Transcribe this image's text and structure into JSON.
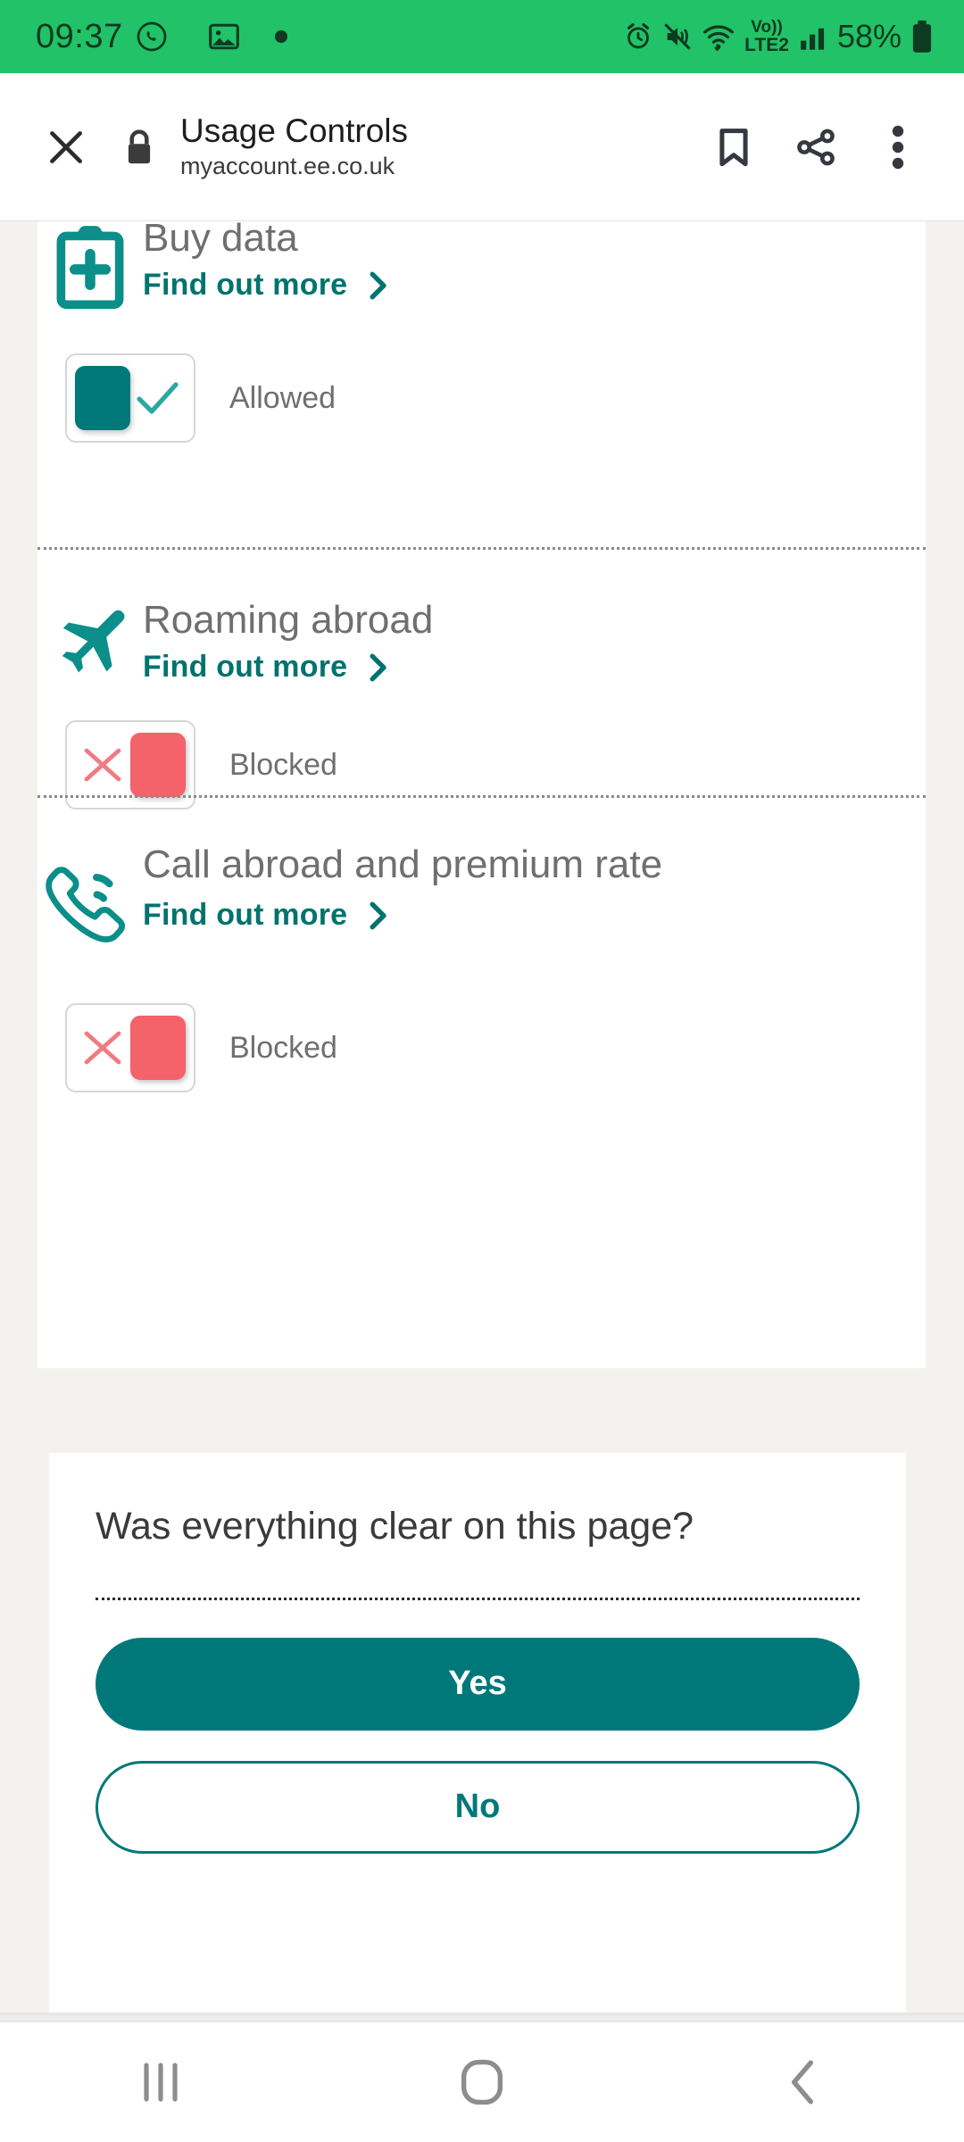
{
  "status_bar": {
    "time": "09:37",
    "battery": "58%",
    "left_icons": [
      "whatsapp-icon",
      "image-icon",
      "dot-indicator-icon"
    ],
    "right_icons": [
      "alarm-icon",
      "mute-vibrate-icon",
      "wifi-icon",
      "volte-lte2-icon",
      "signal-bars-icon",
      "battery-icon"
    ],
    "network_label": "Vo))",
    "network_sub": "LTE2",
    "bg_color": "#22c268"
  },
  "browser": {
    "close_label": "Close",
    "title": "Usage Controls",
    "url": "myaccount.ee.co.uk",
    "secure": true,
    "actions": [
      "bookmark-icon",
      "share-icon",
      "more-menu-icon"
    ]
  },
  "controls": {
    "items": [
      {
        "icon": "buy-data-icon",
        "title": "Buy data",
        "link_label": "Find out more",
        "state": "Allowed",
        "allowed": true
      },
      {
        "icon": "airplane-icon",
        "title": "Roaming abroad",
        "link_label": "Find out more",
        "state": "Blocked",
        "allowed": false
      },
      {
        "icon": "phone-call-icon",
        "title": "Call abroad and premium rate",
        "link_label": "Find out more",
        "state": "Blocked",
        "allowed": false
      }
    ]
  },
  "feedback": {
    "question": "Was everything clear on this page?",
    "yes_label": "Yes",
    "no_label": "No"
  },
  "nav_bar": {
    "recents_label": "Recent apps",
    "home_label": "Home",
    "back_label": "Back"
  },
  "colors": {
    "teal": "#00787a",
    "teal_link": "#00736e",
    "red": "#f4626a",
    "status_green": "#22c268",
    "page_bg": "#f4f2ee"
  }
}
